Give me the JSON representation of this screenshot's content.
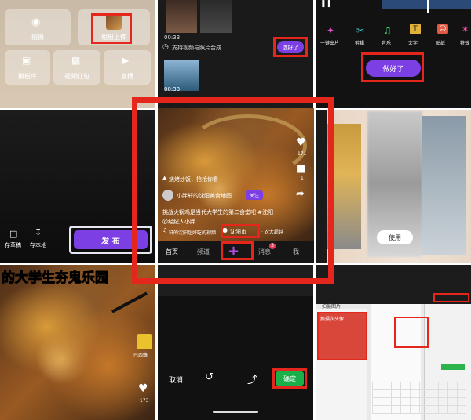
{
  "panel1": {
    "buttons": [
      "拍摄",
      "相册上传",
      "模板库",
      "视频红包",
      "直播"
    ]
  },
  "panel2": {
    "duration_top": "00:33",
    "notice": "支持视频与照片合成",
    "thumb_duration": "00:33",
    "select_button": "选好了"
  },
  "panel3": {
    "tools": [
      "一键出片",
      "剪辑",
      "音乐",
      "文字",
      "贴纸",
      "特效"
    ],
    "done_button": "做好了"
  },
  "panel4": {
    "draft": "存草稿",
    "save_local": "存本地",
    "publish": "发 布"
  },
  "panel5": {
    "hint": "烧烤炒饭，抢抢你看",
    "author": "小胖轩的沈阳美食地图",
    "follow": "关注",
    "caption": "挑战火锅鸡是当代大学生的第二食堂吧 #沈阳",
    "mention": "@经纪人小胖",
    "music": "轩的沈阳超好吃的视频",
    "location": "沈阳市",
    "location_extra": "· 农大超越",
    "like_count": "171",
    "comment_count": "1",
    "nav": [
      "首页",
      "频道",
      "消息",
      "我"
    ],
    "msg_badge": "3"
  },
  "panel6": {
    "use_button": "使用"
  },
  "panel7": {
    "banner": "的大学生夯鬼乐园",
    "badge": "巴西蜂",
    "like_count": "173"
  },
  "panel8": {
    "cancel": "取消",
    "confirm": "确定"
  },
  "panel9": {
    "title": "拍摄图片",
    "item": "换摄次头像"
  }
}
